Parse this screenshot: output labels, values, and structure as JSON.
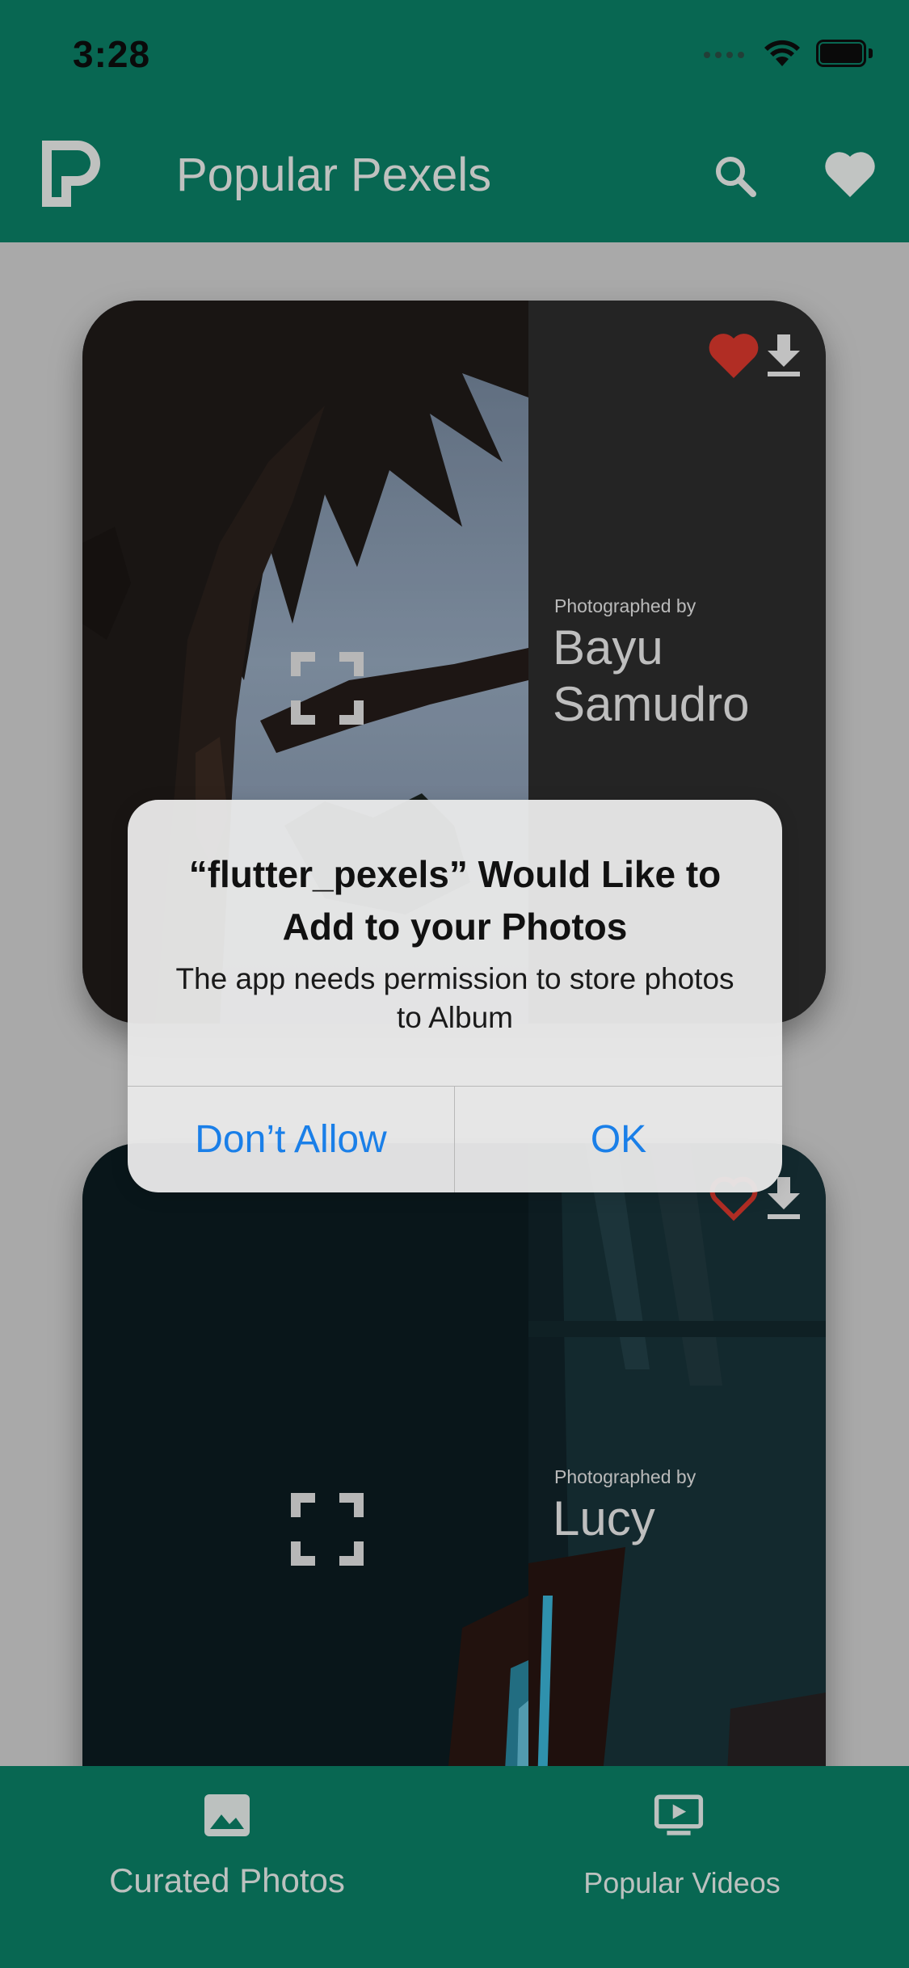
{
  "status_bar": {
    "time": "3:28"
  },
  "header": {
    "title": "Popular Pexels",
    "background_color": "#0a7e64",
    "icons": [
      "pexels-logo-icon",
      "search-icon",
      "heart-icon"
    ]
  },
  "cards": [
    {
      "photographed_by_label": "Photographed by",
      "photographer": "Bayu Samudro",
      "favorited": true,
      "heart_color": "#d8372d"
    },
    {
      "photographed_by_label": "Photographed by",
      "photographer": "Lucy",
      "favorited": false,
      "heart_color": "#d8372d"
    }
  ],
  "alert": {
    "title": "“flutter_pexels” Would Like to Add to your Photos",
    "message": "The app needs permission to store photos to Album",
    "deny_label": "Don’t Allow",
    "ok_label": "OK",
    "button_color": "#1a7fe8"
  },
  "bottom_nav": {
    "items": [
      {
        "label": "Curated Photos",
        "icon": "image-icon"
      },
      {
        "label": "Popular Videos",
        "icon": "video-icon"
      }
    ]
  }
}
